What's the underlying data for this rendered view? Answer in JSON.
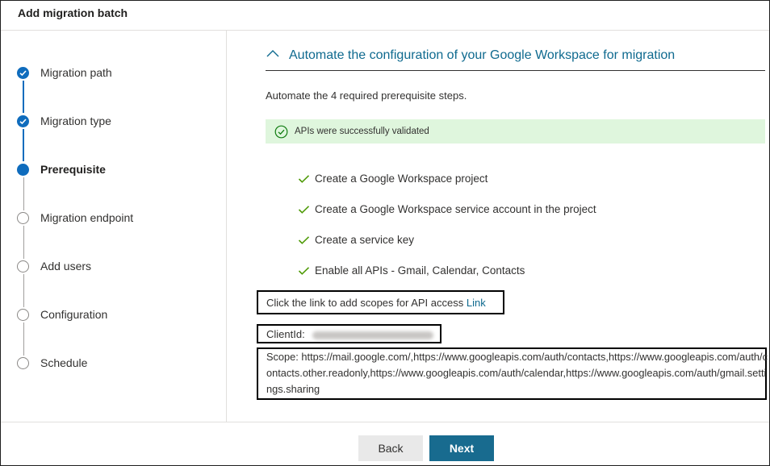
{
  "dialog": {
    "title": "Add migration batch"
  },
  "steps": [
    {
      "label": "Migration path",
      "state": "done"
    },
    {
      "label": "Migration type",
      "state": "done"
    },
    {
      "label": "Prerequisite",
      "state": "current"
    },
    {
      "label": "Migration endpoint",
      "state": "todo"
    },
    {
      "label": "Add users",
      "state": "todo"
    },
    {
      "label": "Configuration",
      "state": "todo"
    },
    {
      "label": "Schedule",
      "state": "todo"
    }
  ],
  "section": {
    "title": "Automate the configuration of your Google Workspace for migration",
    "intro": "Automate the 4 required prerequisite steps.",
    "banner": "APIs were successfully validated",
    "checklist": [
      "Create a Google Workspace project",
      "Create a Google Workspace service account in the project",
      "Create a service key",
      "Enable all APIs - Gmail, Calendar, Contacts"
    ],
    "scopes_prompt": "Click the link to add scopes for API access",
    "scopes_link": "Link",
    "client_id_label": "ClientId:",
    "scope_text": "Scope: https://mail.google.com/,https://www.googleapis.com/auth/contacts,https://www.googleapis.com/auth/contacts.other.readonly,https://www.googleapis.com/auth/calendar,https://www.googleapis.com/auth/gmail.settings.sharing"
  },
  "footer": {
    "back_label": "Back",
    "next_label": "Next"
  },
  "colors": {
    "accent": "#0f6cbd",
    "success_bg": "#dff6dd",
    "success_fg": "#107c10",
    "primary_button": "#186b8f"
  }
}
